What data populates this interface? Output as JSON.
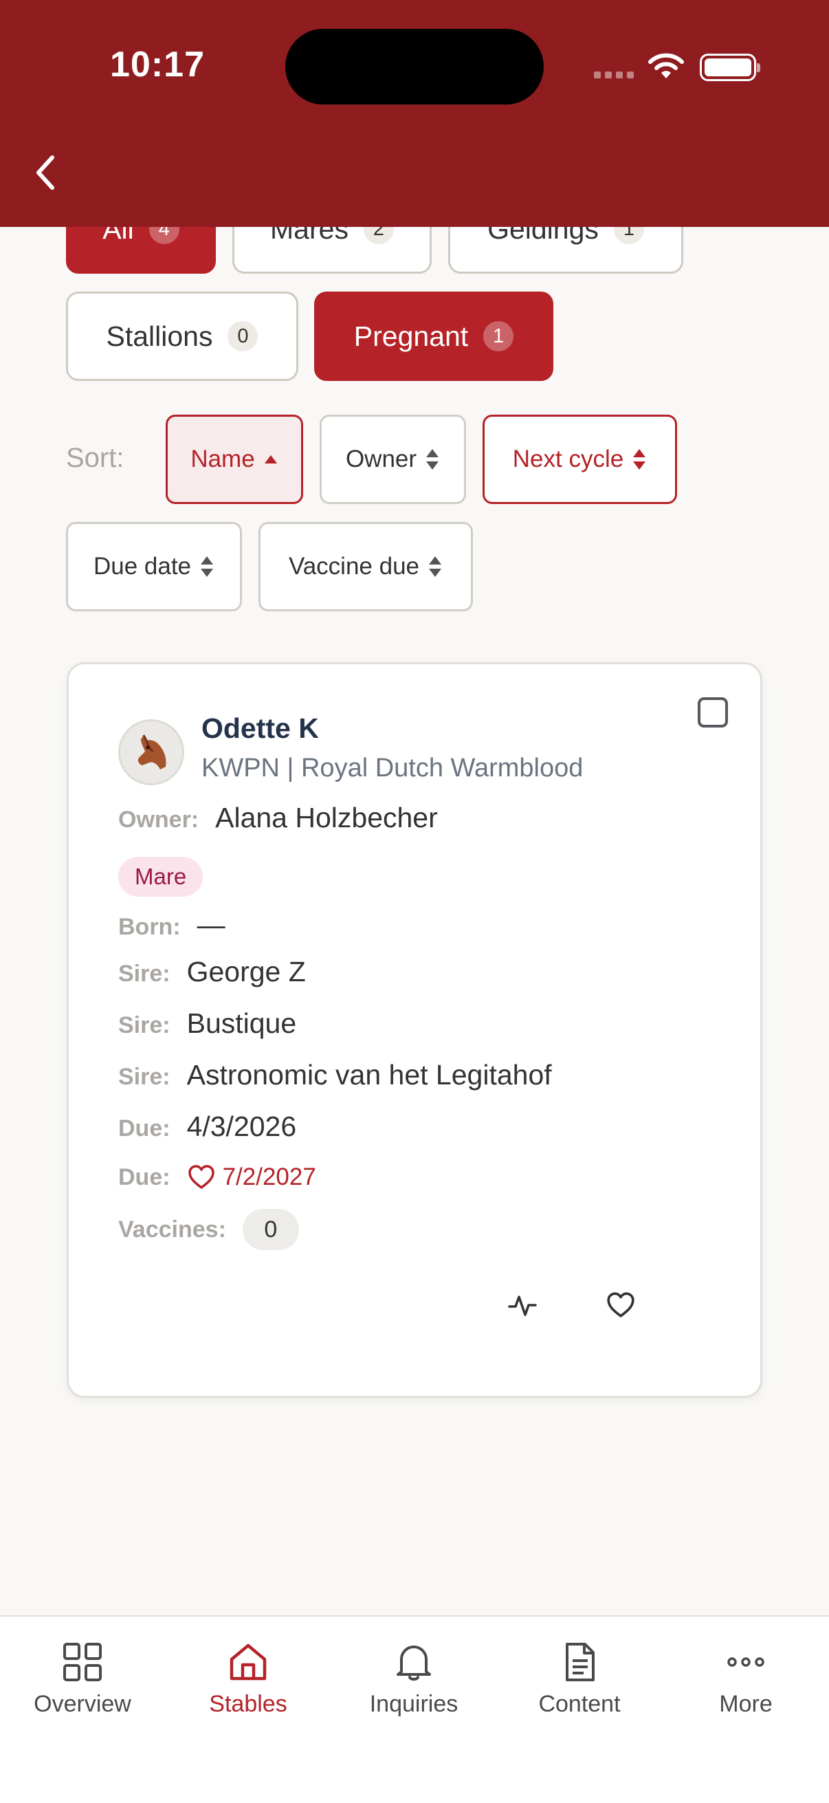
{
  "status_bar": {
    "time": "10:17"
  },
  "filters": [
    {
      "label": "All",
      "count": "4",
      "active": true
    },
    {
      "label": "Mares",
      "count": "2",
      "active": false
    },
    {
      "label": "Geldings",
      "count": "1",
      "active": false
    },
    {
      "label": "Stallions",
      "count": "0",
      "active": false
    },
    {
      "label": "Pregnant",
      "count": "1",
      "active": true
    }
  ],
  "sort": {
    "label": "Sort:",
    "options": [
      {
        "label": "Name",
        "state": "selected-asc"
      },
      {
        "label": "Owner",
        "state": "none"
      },
      {
        "label": "Next cycle",
        "state": "highlighted"
      },
      {
        "label": "Due date",
        "state": "none"
      },
      {
        "label": "Vaccine due",
        "state": "none"
      }
    ]
  },
  "horse": {
    "name": "Odette K",
    "breed": "KWPN | Royal Dutch Warmblood",
    "owner_label": "Owner:",
    "owner": "Alana Holzbecher",
    "sex_tag": "Mare",
    "born_label": "Born:",
    "born": "—",
    "sire_label": "Sire:",
    "sires": [
      "George Z",
      "Bustique",
      "Astronomic van het Legitahof"
    ],
    "due_label": "Due:",
    "due_date": "4/3/2026",
    "due_foal": "7/2/2027",
    "vaccines_label": "Vaccines:",
    "vaccines": "0"
  },
  "tabs": [
    {
      "label": "Overview",
      "icon": "grid-icon",
      "active": false
    },
    {
      "label": "Stables",
      "icon": "home-icon",
      "active": true
    },
    {
      "label": "Inquiries",
      "icon": "bell-icon",
      "active": false
    },
    {
      "label": "Content",
      "icon": "document-icon",
      "active": false
    },
    {
      "label": "More",
      "icon": "more-dots-icon",
      "active": false
    }
  ],
  "colors": {
    "brand": "#8f1c1f",
    "accent": "#b52228",
    "mare_tag_bg": "#fbe3ec",
    "mare_tag_text": "#9a1b46"
  }
}
